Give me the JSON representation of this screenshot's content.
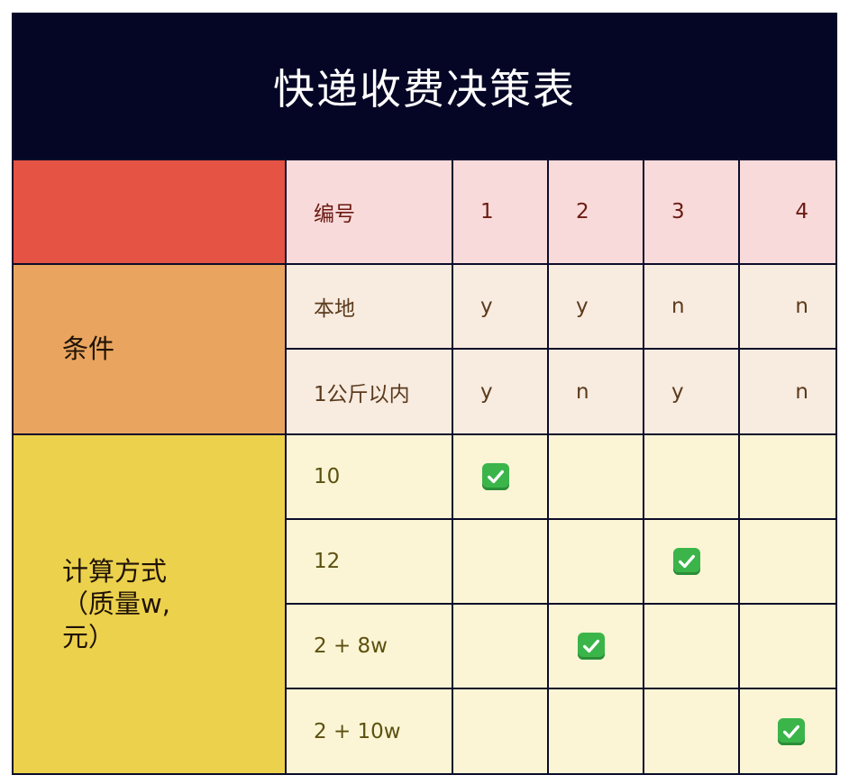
{
  "title": "快递收费决策表",
  "header": {
    "label": "编号",
    "columns": [
      "1",
      "2",
      "3",
      "4"
    ]
  },
  "conditions": {
    "group_label": "条件",
    "rows": [
      {
        "label": "本地",
        "values": [
          "y",
          "y",
          "n",
          "n"
        ]
      },
      {
        "label": "1公斤以内",
        "values": [
          "y",
          "n",
          "y",
          "n"
        ]
      }
    ]
  },
  "calculation": {
    "group_label": "计算方式（质量w, 元）",
    "group_lines": [
      "计算方式",
      "（质量w,",
      "元）"
    ],
    "rows": [
      {
        "label": "10",
        "checked": [
          true,
          false,
          false,
          false
        ]
      },
      {
        "label": "12",
        "checked": [
          false,
          false,
          true,
          false
        ]
      },
      {
        "label": "2 + 8w",
        "checked": [
          false,
          true,
          false,
          false
        ]
      },
      {
        "label": "2 + 10w",
        "checked": [
          false,
          false,
          false,
          true
        ]
      }
    ]
  },
  "colors": {
    "title_bg": "#050626",
    "header_corner": "#e45343",
    "conditions_group": "#e9a55f",
    "calculation_group": "#ecd14c",
    "check": "#3bb54a"
  },
  "icons": {
    "check": "check-mark-button-icon"
  }
}
